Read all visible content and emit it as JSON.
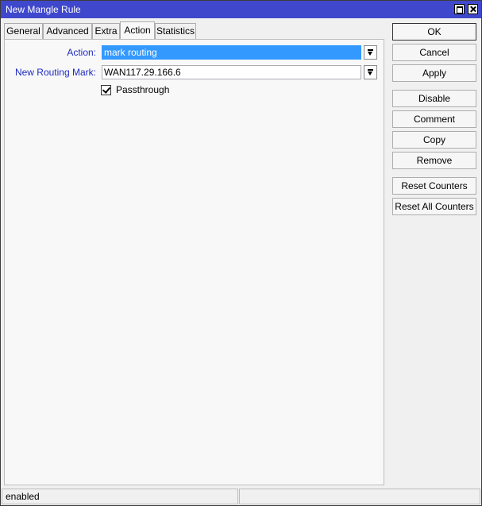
{
  "window": {
    "title": "New Mangle Rule"
  },
  "tabs": [
    {
      "label": "General"
    },
    {
      "label": "Advanced"
    },
    {
      "label": "Extra"
    },
    {
      "label": "Action"
    },
    {
      "label": "Statistics"
    }
  ],
  "active_tab": "Action",
  "form": {
    "action_label": "Action:",
    "action_value": "mark routing",
    "routing_mark_label": "New Routing Mark:",
    "routing_mark_value": "WAN117.29.166.6",
    "passthrough_label": "Passthrough",
    "passthrough_checked": true
  },
  "buttons": {
    "ok": "OK",
    "cancel": "Cancel",
    "apply": "Apply",
    "disable": "Disable",
    "comment": "Comment",
    "copy": "Copy",
    "remove": "Remove",
    "reset_counters": "Reset Counters",
    "reset_all_counters": "Reset All Counters"
  },
  "status": {
    "left": "enabled",
    "right": ""
  },
  "colors": {
    "titlebar": "#3f48cc",
    "label_blue": "#1f2bbf",
    "selection": "#3399ff"
  }
}
